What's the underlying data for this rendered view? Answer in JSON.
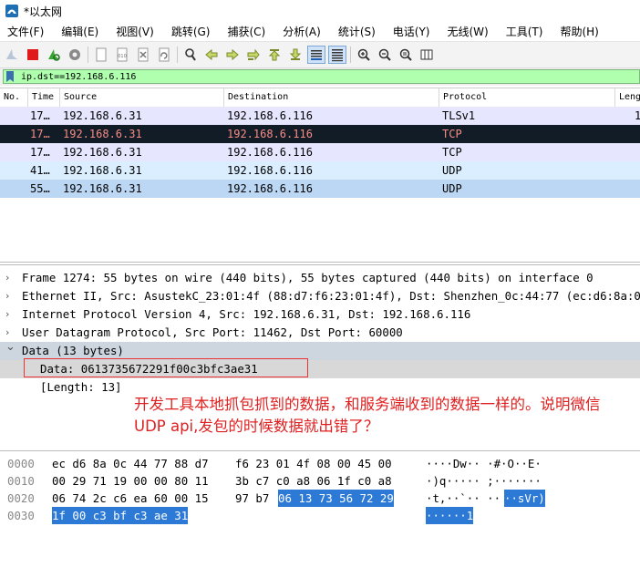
{
  "window": {
    "title": "*以太网"
  },
  "menu": [
    "文件(F)",
    "编辑(E)",
    "视图(V)",
    "跳转(G)",
    "捕获(C)",
    "分析(A)",
    "统计(S)",
    "电话(Y)",
    "无线(W)",
    "工具(T)",
    "帮助(H)"
  ],
  "toolbar_icons": [
    "shark-fin-start-icon",
    "stop-icon",
    "restart-icon",
    "gear-options-icon",
    "open-file-icon",
    "save-file-icon",
    "close-file-icon",
    "reload-icon",
    "find-icon",
    "go-back-icon",
    "go-forward-icon",
    "go-to-packet-icon",
    "go-first-icon",
    "go-last-icon",
    "auto-scroll-icon",
    "colorize-icon",
    "zoom-in-icon",
    "zoom-out-icon",
    "zoom-reset-icon",
    "resize-columns-icon"
  ],
  "filter": {
    "value": "ip.dst==192.168.6.116"
  },
  "packet_list": {
    "columns": [
      "No.",
      "Time",
      "Source",
      "Destination",
      "Protocol",
      "Leng"
    ],
    "rows": [
      {
        "no": "",
        "time": "17…",
        "source": "192.168.6.31",
        "destination": "192.168.6.116",
        "protocol": "TLSv1",
        "length": "1",
        "bg": "#e7e6ff",
        "fg": "#000000"
      },
      {
        "no": "",
        "time": "17…",
        "source": "192.168.6.31",
        "destination": "192.168.6.116",
        "protocol": "TCP",
        "length": "",
        "bg": "#121c27",
        "fg": "#f78c85"
      },
      {
        "no": "",
        "time": "17…",
        "source": "192.168.6.31",
        "destination": "192.168.6.116",
        "protocol": "TCP",
        "length": "",
        "bg": "#e7e6ff",
        "fg": "#000000"
      },
      {
        "no": "",
        "time": "41…",
        "source": "192.168.6.31",
        "destination": "192.168.6.116",
        "protocol": "UDP",
        "length": "",
        "bg": "#daeeff",
        "fg": "#000000"
      },
      {
        "no": "",
        "time": "55…",
        "source": "192.168.6.31",
        "destination": "192.168.6.116",
        "protocol": "UDP",
        "length": "",
        "bg": "#bcd7f3",
        "fg": "#000000"
      }
    ]
  },
  "details": {
    "lines": [
      {
        "text": "Frame 1274: 55 bytes on wire (440 bits), 55 bytes captured (440 bits) on interface 0",
        "state": "collapsed"
      },
      {
        "text": "Ethernet II, Src: AsustekC_23:01:4f (88:d7:f6:23:01:4f), Dst: Shenzhen_0c:44:77 (ec:d6:8a:0c:44:77)",
        "state": "collapsed"
      },
      {
        "text": "Internet Protocol Version 4, Src: 192.168.6.31, Dst: 192.168.6.116",
        "state": "collapsed"
      },
      {
        "text": "User Datagram Protocol, Src Port: 11462, Dst Port: 60000",
        "state": "collapsed"
      },
      {
        "text": "Data (13 bytes)",
        "state": "expanded"
      },
      {
        "text": "Data: 0613735672291f00c3bfc3ae31",
        "state": "leaf"
      },
      {
        "text": "[Length: 13]",
        "state": "leaf"
      }
    ],
    "annotation": "开发工具本地抓包抓到的数据，和服务端收到的数据一样的。说明微信UDP api,发包的时候数据就出错了？"
  },
  "bytes": {
    "rows": [
      {
        "offset": "0000",
        "hex_a": "ec d6 8a 0c 44 77 88 d7",
        "hex_b": "f6 23 01 4f 08 00 45 00",
        "hex_b_hl": "",
        "ascii": "····Dw·· ·#·O··E·",
        "ascii_hl": ""
      },
      {
        "offset": "0010",
        "hex_a": "00 29 71 19 00 00 80 11",
        "hex_b": "3b c7 c0 a8 06 1f c0 a8",
        "hex_b_hl": "",
        "ascii": "·)q····· ;·······",
        "ascii_hl": ""
      },
      {
        "offset": "0020",
        "hex_a": "06 74 2c c6 ea 60 00 15",
        "hex_b": "97 b7",
        "hex_b_hl": "06 13 73 56 72 29",
        "ascii": "·t,··`·· ··",
        "ascii_hl": "··sVr)"
      },
      {
        "offset": "0030",
        "hex_a": "",
        "hex_a_hl": "1f 00 c3 bf c3 ae 31",
        "hex_b": "",
        "hex_b_hl": "",
        "ascii": "",
        "ascii_hl": "······1"
      }
    ]
  }
}
